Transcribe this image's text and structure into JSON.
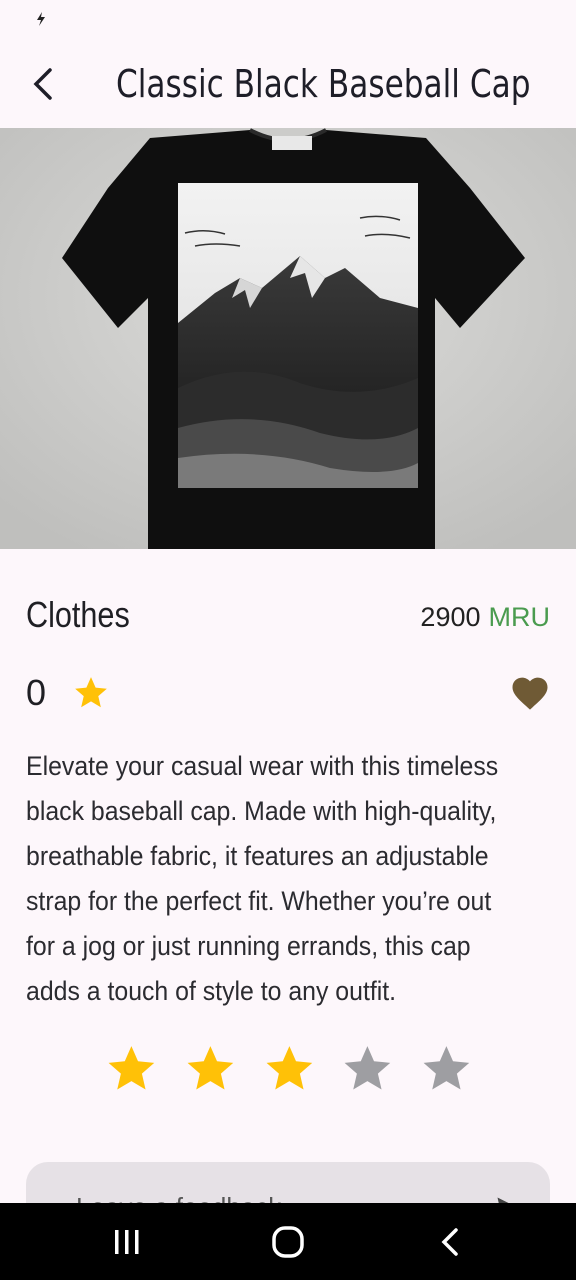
{
  "app_bar": {
    "title": "Classic Black Baseball Cap",
    "back_icon": "back-arrow-icon"
  },
  "product": {
    "category": "Clothes",
    "price": "2900",
    "currency": "MRU",
    "rating_count": "0",
    "description": "Elevate your casual wear with this timeless black baseball cap. Made with high-quality, breathable fabric, it features an adjustable strap for the perfect fit. Whether you’re out for a jog or just running errands, this cap adds a touch of style to any outfit.",
    "user_rating": 3,
    "max_rating": 5
  },
  "feedback": {
    "placeholder": "Leave a feedback",
    "send_icon": "send-icon"
  },
  "colors": {
    "star_active": "#ffc107",
    "star_inactive": "#9e9ea2",
    "heart": "#6f5a35",
    "currency": "#4a9b4f"
  }
}
